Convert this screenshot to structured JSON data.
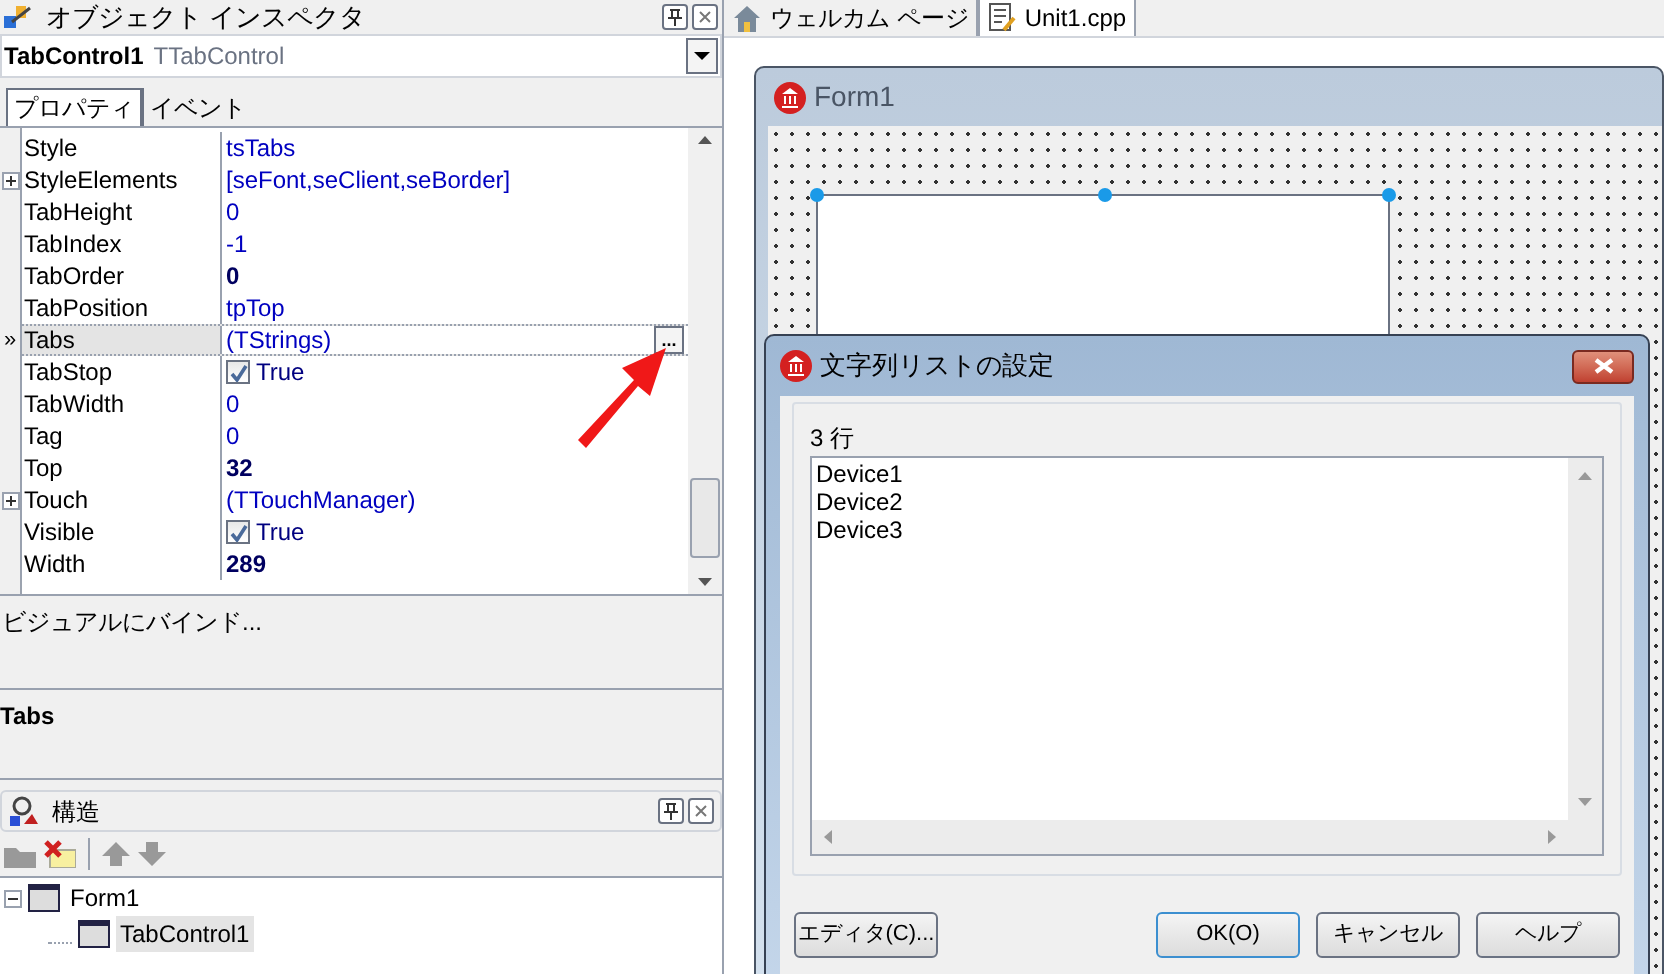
{
  "inspector": {
    "title": "オブジェクト インスペクタ",
    "object_name": "TabControl1",
    "object_type": "TTabControl",
    "tabs": [
      {
        "label": "プロパティ",
        "selected": true
      },
      {
        "label": "イベント",
        "selected": false
      }
    ],
    "properties": [
      {
        "name": "Style",
        "value": "tsTabs",
        "kind": "text",
        "expandable": false,
        "selected": false
      },
      {
        "name": "StyleElements",
        "value": "[seFont,seClient,seBorder]",
        "kind": "text",
        "expandable": true,
        "selected": false
      },
      {
        "name": "TabHeight",
        "value": "0",
        "kind": "text",
        "expandable": false,
        "selected": false
      },
      {
        "name": "TabIndex",
        "value": "-1",
        "kind": "text",
        "expandable": false,
        "selected": false
      },
      {
        "name": "TabOrder",
        "value": "0",
        "kind": "bold",
        "expandable": false,
        "selected": false
      },
      {
        "name": "TabPosition",
        "value": "tpTop",
        "kind": "text",
        "expandable": false,
        "selected": false
      },
      {
        "name": "Tabs",
        "value": "(TStrings)",
        "kind": "text",
        "expandable": false,
        "selected": true,
        "ellipsis": "..."
      },
      {
        "name": "TabStop",
        "value": "True",
        "kind": "checkbox",
        "checked": true,
        "expandable": false,
        "selected": false
      },
      {
        "name": "TabWidth",
        "value": "0",
        "kind": "text",
        "expandable": false,
        "selected": false
      },
      {
        "name": "Tag",
        "value": "0",
        "kind": "text",
        "expandable": false,
        "selected": false
      },
      {
        "name": "Top",
        "value": "32",
        "kind": "bold",
        "expandable": false,
        "selected": false
      },
      {
        "name": "Touch",
        "value": "(TTouchManager)",
        "kind": "text",
        "expandable": true,
        "selected": false
      },
      {
        "name": "Visible",
        "value": "True",
        "kind": "checkbox",
        "checked": true,
        "expandable": false,
        "selected": false
      },
      {
        "name": "Width",
        "value": "289",
        "kind": "bold",
        "expandable": false,
        "selected": false
      }
    ],
    "selected_marker": "»",
    "bind_link": "ビジュアルにバインド...",
    "help_title": "Tabs"
  },
  "structure": {
    "title": "構造",
    "tree": [
      {
        "label": "Form1",
        "expanded": true,
        "children": [
          {
            "label": "TabControl1",
            "selected": true
          }
        ]
      }
    ]
  },
  "editor_tabs": [
    {
      "label": "ウェルカム ページ",
      "selected": false
    },
    {
      "label": "Unit1.cpp",
      "selected": true
    }
  ],
  "form": {
    "title": "Form1"
  },
  "dialog": {
    "title": "文字列リストの設定",
    "count": "3 行",
    "lines": [
      "Device1",
      "Device2",
      "Device3"
    ],
    "buttons": [
      {
        "label": "エディタ(C)...",
        "default": false
      },
      {
        "label": "OK(O)",
        "default": true
      },
      {
        "label": "キャンセル",
        "default": false
      },
      {
        "label": "ヘルプ",
        "default": false
      }
    ]
  }
}
